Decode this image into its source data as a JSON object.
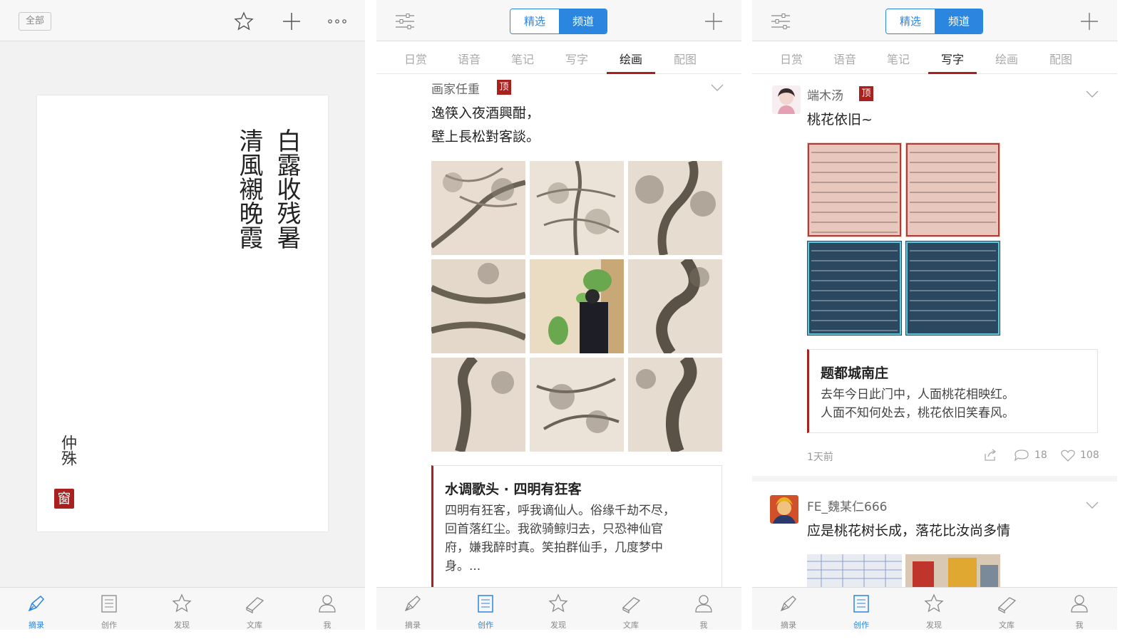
{
  "colors": {
    "accent_blue": "#2b86e0",
    "seal_red": "#a8211f",
    "inactive": "#888888"
  },
  "panel1": {
    "topbar": {
      "all_label": "全部",
      "icons": [
        "star-icon",
        "plus-icon",
        "more-icon"
      ]
    },
    "card": {
      "col_right": "白露收残暑",
      "col_left": "清風襯晚霞",
      "author": "仲殊",
      "seal": "窗"
    },
    "tabs": [
      {
        "label": "摘录",
        "icon": "pen-icon",
        "active": true
      },
      {
        "label": "创作",
        "icon": "document-icon",
        "active": false
      },
      {
        "label": "发现",
        "icon": "star-icon",
        "active": false
      },
      {
        "label": "文库",
        "icon": "books-icon",
        "active": false
      },
      {
        "label": "我",
        "icon": "person-icon",
        "active": false
      }
    ]
  },
  "panel2": {
    "segment": {
      "left": "精选",
      "right": "频道",
      "selected": "频道"
    },
    "channels": [
      "日赏",
      "语音",
      "笔记",
      "写字",
      "绘画",
      "配图"
    ],
    "active_channel": "绘画",
    "post": {
      "user": "画家任重",
      "badge": "顶",
      "text_line1": "逸筷入夜酒興酣，",
      "text_line2": "壁上長松對客談。",
      "quote_title": "水调歌头 · 四明有狂客",
      "quote_line1": "四明有狂客，呼我谪仙人。俗缘千劫不尽，",
      "quote_line2": "回首落红尘。我欲骑鲸归去，只恐神仙官",
      "quote_line3": "府，嫌我醉时真。笑拍群仙手，几度梦中",
      "quote_line4": "身。..."
    },
    "tabs": [
      {
        "label": "摘录",
        "icon": "pen-icon",
        "active": false
      },
      {
        "label": "创作",
        "icon": "document-icon",
        "active": true
      },
      {
        "label": "发现",
        "icon": "star-icon",
        "active": false
      },
      {
        "label": "文库",
        "icon": "books-icon",
        "active": false
      },
      {
        "label": "我",
        "icon": "person-icon",
        "active": false
      }
    ]
  },
  "panel3": {
    "segment": {
      "left": "精选",
      "right": "频道",
      "selected": "频道"
    },
    "channels": [
      "日赏",
      "语音",
      "笔记",
      "写字",
      "绘画",
      "配图"
    ],
    "active_channel": "写字",
    "post1": {
      "user": "端木汤",
      "badge": "顶",
      "text": "桃花依旧~",
      "quote_title": "题都城南庄",
      "quote_line1": "去年今日此门中，人面桃花相映红。",
      "quote_line2": "人面不知何处去，桃花依旧笑春风。",
      "time": "1天前",
      "comments": "18",
      "likes": "108"
    },
    "post2": {
      "user": "FE_魏某仁666",
      "text": "应是桃花树长成，落花比汝尚多情"
    },
    "tabs": [
      {
        "label": "摘录",
        "icon": "pen-icon",
        "active": false
      },
      {
        "label": "创作",
        "icon": "document-icon",
        "active": true
      },
      {
        "label": "发现",
        "icon": "star-icon",
        "active": false
      },
      {
        "label": "文库",
        "icon": "books-icon",
        "active": false
      },
      {
        "label": "我",
        "icon": "person-icon",
        "active": false
      }
    ]
  }
}
